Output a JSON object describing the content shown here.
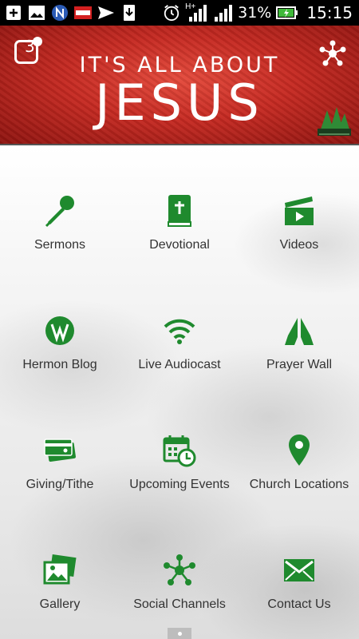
{
  "status_bar": {
    "battery": "31%",
    "time": "15:15",
    "network": "H+",
    "left_icons": [
      "add-icon",
      "image-icon",
      "n-app-icon",
      "punch-app-icon",
      "send-icon",
      "download-icon"
    ]
  },
  "header": {
    "banner_line1": "IT'S ALL ABOUT",
    "banner_line2": "JESUS",
    "notification_count": "3"
  },
  "menu": [
    {
      "label": "Sermons",
      "icon": "microphone-icon"
    },
    {
      "label": "Devotional",
      "icon": "bible-icon"
    },
    {
      "label": "Videos",
      "icon": "clapperboard-icon"
    },
    {
      "label": "Hermon Blog",
      "icon": "wordpress-icon"
    },
    {
      "label": "Live Audiocast",
      "icon": "wifi-icon"
    },
    {
      "label": "Prayer Wall",
      "icon": "praying-hands-icon"
    },
    {
      "label": "Giving/Tithe",
      "icon": "credit-cards-icon"
    },
    {
      "label": "Upcoming Events",
      "icon": "calendar-clock-icon"
    },
    {
      "label": "Church Locations",
      "icon": "map-pin-icon"
    },
    {
      "label": "Gallery",
      "icon": "photos-icon"
    },
    {
      "label": "Social Channels",
      "icon": "network-icon"
    },
    {
      "label": "Contact Us",
      "icon": "envelope-icon"
    }
  ],
  "colors": {
    "accent": "#1f8a2e",
    "banner_red": "#c62a22",
    "status_bar": "#000000"
  }
}
